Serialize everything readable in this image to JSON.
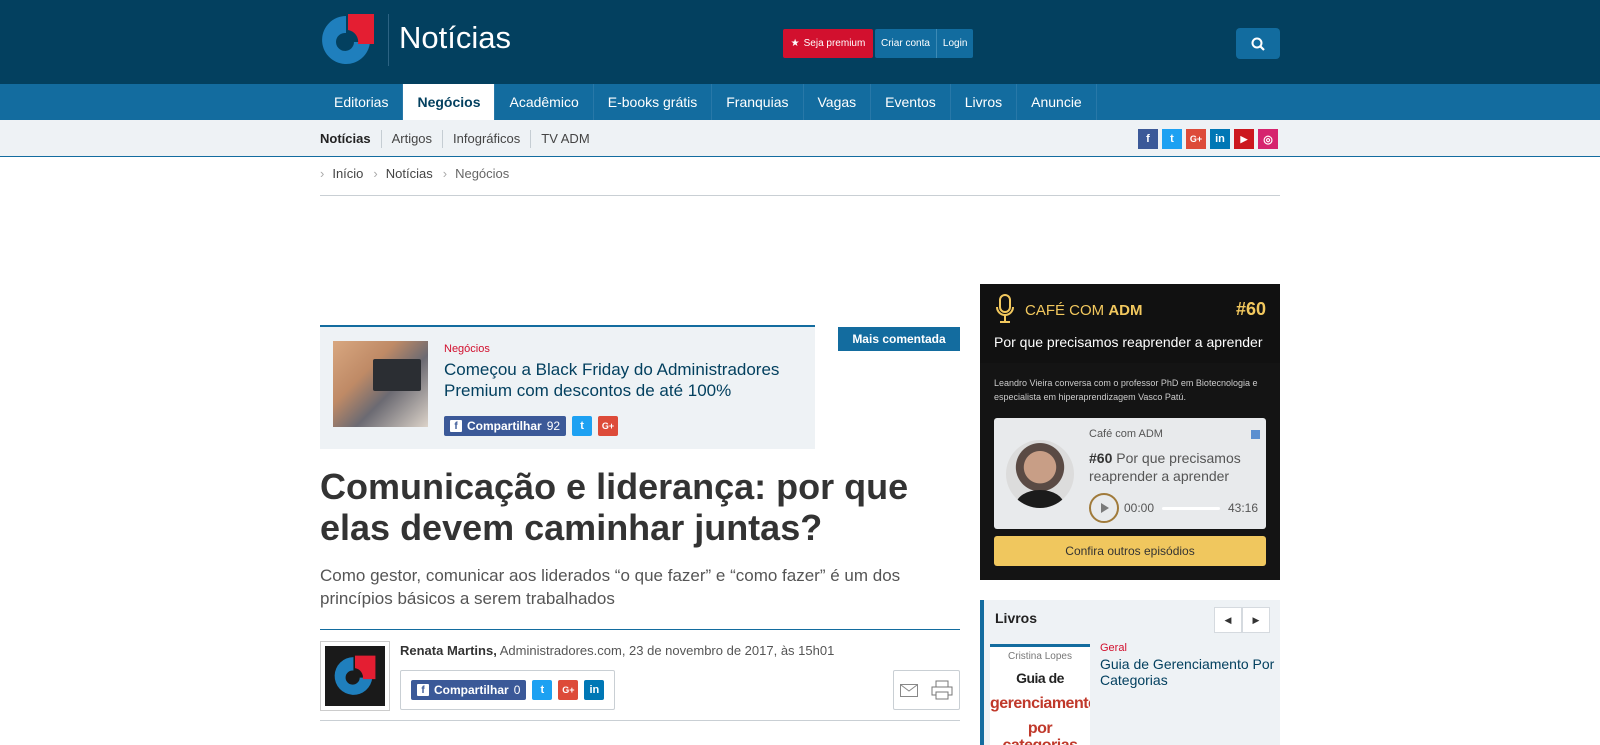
{
  "header": {
    "site_title": "Notícias",
    "premium_label": "Seja premium",
    "create_account_label": "Criar conta",
    "login_label": "Login",
    "brand_color": "#03405f",
    "accent_red": "#d2102e"
  },
  "mainnav": [
    "Editorias",
    "Negócios",
    "Acadêmico",
    "E-books grátis",
    "Franquias",
    "Vagas",
    "Eventos",
    "Livros",
    "Anuncie"
  ],
  "subnav": [
    "Notícias",
    "Artigos",
    "Infográficos",
    "TV ADM"
  ],
  "social": [
    {
      "icon": "facebook-icon",
      "glyph": "f",
      "color": "#3b5998"
    },
    {
      "icon": "twitter-icon",
      "glyph": "t",
      "color": "#1da1f2"
    },
    {
      "icon": "google-plus-icon",
      "glyph": "G+",
      "color": "#dd4b39"
    },
    {
      "icon": "linkedin-icon",
      "glyph": "in",
      "color": "#0077b5"
    },
    {
      "icon": "youtube-icon",
      "glyph": "▶",
      "color": "#cc181e"
    },
    {
      "icon": "instagram-icon",
      "glyph": "◎",
      "color": "#d6246e"
    }
  ],
  "breadcrumb": [
    "Início",
    "Notícias",
    "Negócios"
  ],
  "featured": {
    "category": "Negócios",
    "title": "Começou a Black Friday do Administradores Premium com descontos de até 100%",
    "share_label": "Compartilhar",
    "share_count": "92",
    "badge": "Mais comentada"
  },
  "article": {
    "headline": "Comunicação e liderança: por que elas devem caminhar juntas?",
    "dek": "Como gestor, comunicar aos liderados “o que fazer” e “como fazer” é um dos princípios básicos a serem trabalhados",
    "author": "Renata Martins,",
    "meta": "Administradores.com, 23 de novembro de 2017, às 15h01",
    "share_label": "Compartilhar",
    "share_count": "0"
  },
  "podcast": {
    "name_prefix": "CAFÉ COM",
    "name_bold": "ADM",
    "number": "#60",
    "title": "Por que precisamos reaprender a aprender",
    "description": "Leandro Vieira conversa com o professor PhD em Biotecnologia e especialista em hiperaprendizagem Vasco Patú.",
    "player_show": "Café com ADM",
    "player_ep_number": "#60",
    "player_ep_title": "Por que precisamos reaprender a aprender",
    "current_time": "00:00",
    "duration": "43:16",
    "more_button": "Confira outros episódios",
    "accent": "#f0c75e"
  },
  "books": {
    "section_title": "Livros",
    "cover_author": "Cristina Lopes",
    "cover_title_line1": "Guia de",
    "cover_title_line2": "gerenciamento",
    "cover_title_line3": "por categorias",
    "category": "Geral",
    "title": "Guia de Gerenciamento Por Categorias"
  }
}
